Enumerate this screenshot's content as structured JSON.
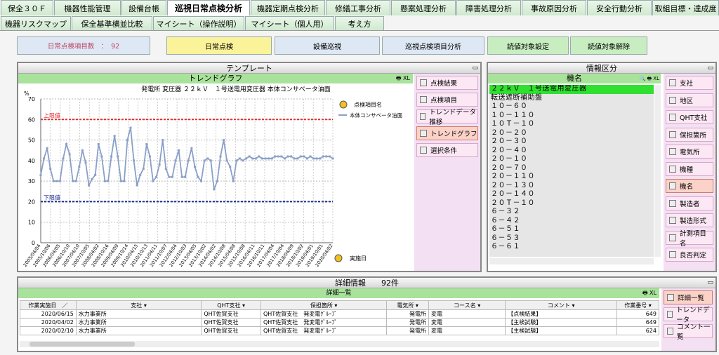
{
  "tabs_row1": [
    "保全３０Ｆ",
    "機器性能管理",
    "設備台帳",
    "巡視日常点検分析",
    "機器定期点検分析",
    "修繕工事分析",
    "懸案処理分析",
    "障害処理分析",
    "事故原因分析",
    "安全行動分析",
    "取組目標・達成度"
  ],
  "tabs_row2": [
    "機器リスクマップ",
    "保全基準横並比較",
    "マイシート（操作説明）",
    "マイシート（個人用）",
    "考え方"
  ],
  "toolbar": {
    "count_label": "日常点検項目数　：　92",
    "b1": "日常点検",
    "b2": "設備巡視",
    "b3": "巡視点検項目分析",
    "b4": "読値対象設定",
    "b5": "読値対象解除"
  },
  "template_panel": {
    "title": "テンプレート",
    "subtitle": "トレンドグラフ",
    "icons": "🖶 XL"
  },
  "chart_data": {
    "type": "line",
    "title": "発電所 変圧器 ２２ｋＶ　１号送電用変圧器 本体コンサベータ油面",
    "ylabel": "%",
    "ylim": [
      0,
      70
    ],
    "yticks": [
      0,
      10,
      20,
      30,
      40,
      50,
      60,
      70
    ],
    "upper_label": "上限値",
    "upper": 60,
    "lower_label": "下限値",
    "lower": 20,
    "legend_title": "点検項目名",
    "series_name": "本体コンサベータ油面",
    "x_axis_button": "実施日",
    "xticks": [
      "2005/04/04",
      "2005/10/06",
      "2006/04/05",
      "2006/10/10",
      "2007/04/10",
      "2007/10/05",
      "2008/04/02",
      "2008/10/16",
      "2009/04/09",
      "2009/10/14",
      "2010/04/15",
      "2010/10/13",
      "2011/04/11",
      "2011/10/07",
      "2012/04/04",
      "2012/10/03",
      "2013/04/05",
      "2013/10/02",
      "2014/04/02",
      "2014/10/08",
      "2015/04/08",
      "2015/10/08",
      "2016/04/11",
      "2016/10/11",
      "2017/04/04",
      "2017/10/04",
      "2018/04/09",
      "2018/10/02",
      "2019/04/01",
      "2019/10/01",
      "2020/04/02"
    ],
    "values": [
      33,
      41,
      46,
      36,
      30,
      30,
      30,
      41,
      48,
      43,
      30,
      30,
      37,
      45,
      39,
      28,
      31,
      33,
      48,
      42,
      30,
      30,
      42,
      52,
      42,
      30,
      30,
      50,
      56,
      40,
      28,
      33,
      36,
      48,
      42,
      30,
      32,
      38,
      50,
      36,
      32,
      32,
      40,
      45,
      32,
      32,
      40,
      46,
      37,
      32,
      30,
      40,
      41,
      40,
      26,
      30,
      42,
      50,
      40,
      37,
      30,
      40,
      41,
      40,
      41,
      42,
      41,
      41,
      42,
      41,
      41,
      41,
      41,
      42,
      42,
      42,
      41,
      42,
      42,
      41,
      41,
      42,
      42,
      41,
      42,
      41,
      41,
      41,
      42,
      42,
      42,
      41
    ]
  },
  "template_side": [
    "点検結果",
    "点検項目",
    "トレンドデータ推移",
    "トレンドグラフ",
    "選択条件"
  ],
  "info_panel": {
    "title": "情報区分",
    "header": "機名",
    "icons": "🔍 🖶 XL",
    "items": [
      "２２ｋＶ　１号送電用変圧器",
      "転送遮断補助盤",
      "１０－６０",
      "１０－１１０",
      "１０Ｔ－１０",
      "２０－２０",
      "２０－３０",
      "２０－４０",
      "２０－１０",
      "２０－７０",
      "２０－１１０",
      "２０－１３０",
      "２０－１４０",
      "２０Ｔ－１０",
      "６－３２",
      "６－４２",
      "６－５１",
      "６－５３",
      "６－６１"
    ]
  },
  "info_side": [
    "支社",
    "地区",
    "QHT支社",
    "保担箇所",
    "電気所",
    "機種",
    "機名",
    "製造者",
    "製造形式",
    "計測項目名",
    "良否判定"
  ],
  "detail_panel": {
    "title": "詳細情報　　92件",
    "subtitle": "詳細一覧",
    "icons": "🖶 XL",
    "columns": [
      "作業実施日　／",
      "支社",
      "QHT支社",
      "保担箇所",
      "電気所",
      "コース名",
      "コメント",
      "作業番号"
    ],
    "rows": [
      [
        "2020/06/15",
        "水力事業所",
        "QHT佐賀支社",
        "QHT佐賀支社　発変電ｸﾞﾙｰﾌﾟ",
        "発電所",
        "変電",
        "【点検結果】",
        "649"
      ],
      [
        "2020/04/02",
        "水力事業所",
        "QHT佐賀支社",
        "QHT佐賀支社　発変電ｸﾞﾙｰﾌﾟ",
        "発電所",
        "変電",
        "【主検試験】",
        "649"
      ],
      [
        "2020/02/10",
        "水力事業所",
        "QHT佐賀支社",
        "QHT佐賀支社　発変電ｸﾞﾙｰﾌﾟ",
        "発電所",
        "変電",
        "【主検試験】",
        "624"
      ]
    ]
  },
  "detail_side": [
    "詳細一覧",
    "トレンドデータ",
    "コメント一覧"
  ]
}
